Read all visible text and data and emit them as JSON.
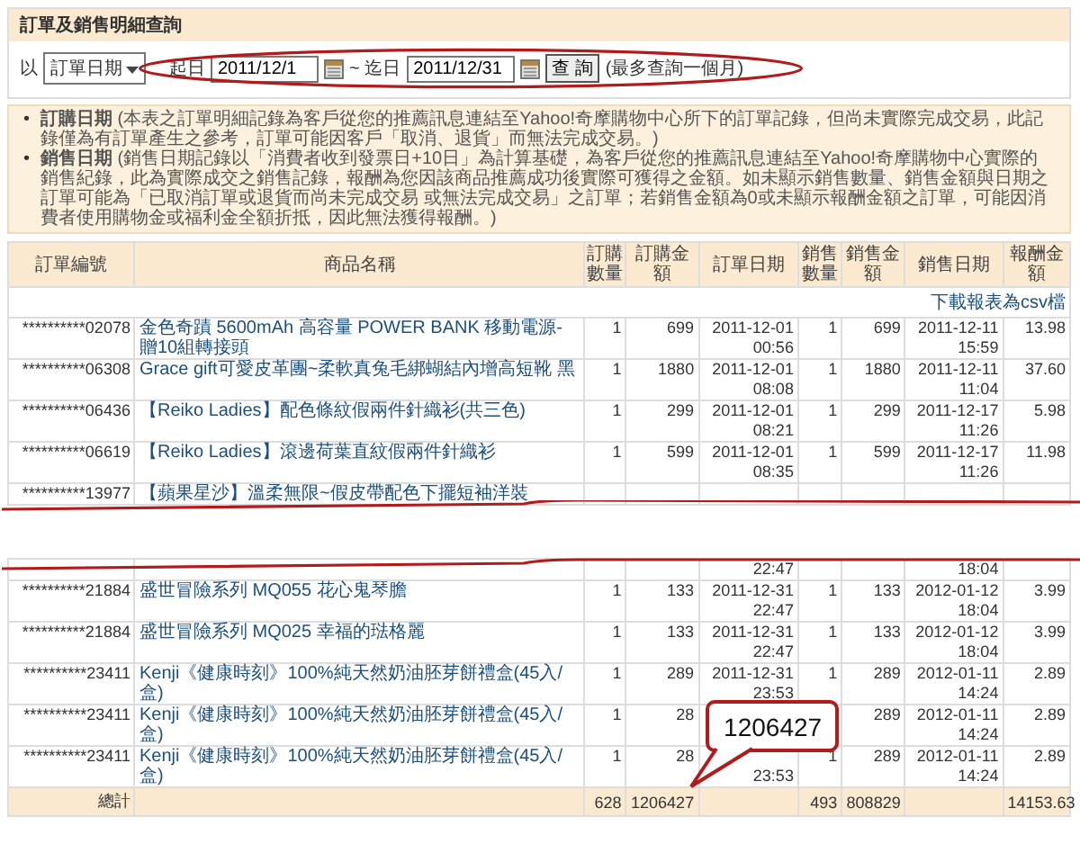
{
  "panel": {
    "title": "訂單及銷售明細查詢"
  },
  "filter": {
    "prefix": "以",
    "field_select": "訂單日期",
    "start_label": "起日",
    "start_date": "2011/12/1",
    "separator": "~ 迄日",
    "end_date": "2011/12/31",
    "button": "查 詢",
    "hint": "(最多查詢一個月)"
  },
  "notes": [
    {
      "marker": "•",
      "text": "**訂購日期** (本表之訂單明細記錄為客戶從您的推薦訊息連結至Yahoo!奇摩購物中心所下的訂單記錄，但尚未實際完成交易，此記錄僅為有訂單產生之參考，訂單可能因客戶「取消、退貨」而無法完成交易。)"
    },
    {
      "marker": "•",
      "text": "**銷售日期** (銷售日期記錄以「消費者收到發票日+10日」為計算基礎，為客戶從您的推薦訊息連結至Yahoo!奇摩購物中心實際的銷售紀錄，此為實際成交之銷售記錄，報酬為您因該商品推薦成功後實際可獲得之金額。如未顯示銷售數量、銷售金額與日期之訂單可能為「已取消訂單或退貨而尚未完成交易 或無法完成交易」之訂單；若銷售金額為0或未顯示報酬金額之訂單，可能因消費者使用購物金或福利金全額折抵，因此無法獲得報酬。)"
    }
  ],
  "table": {
    "columns": [
      "訂單編號",
      "商品名稱",
      "訂購數量",
      "訂購金額",
      "訂單日期",
      "銷售數量",
      "銷售金額",
      "銷售日期",
      "報酬金額"
    ],
    "download_link": "下載報表為csv檔",
    "rows": [
      {
        "kind": "row",
        "cells": [
          "**********02078",
          "金色奇蹟 5600mAh 高容量 POWER BANK 移動電源-贈10組轉接頭",
          "1",
          "699",
          "2011-12-01\n00:56",
          "1",
          "699",
          "2011-12-11\n15:59",
          "13.98"
        ]
      },
      {
        "kind": "row",
        "cells": [
          "**********06308",
          "Grace gift可愛皮革團~柔軟真兔毛綁蝴結內增高短靴 黑",
          "1",
          "1880",
          "2011-12-01\n08:08",
          "1",
          "1880",
          "2011-12-11\n11:04",
          "37.60"
        ]
      },
      {
        "kind": "row",
        "cells": [
          "**********06436",
          "【Reiko Ladies】配色條紋假兩件針織衫(共三色)",
          "1",
          "299",
          "2011-12-01\n08:21",
          "1",
          "299",
          "2011-12-17\n11:26",
          "5.98"
        ]
      },
      {
        "kind": "row",
        "cells": [
          "**********06619",
          "【Reiko Ladies】滾邊荷葉直紋假兩件針織衫",
          "1",
          "599",
          "2011-12-01\n08:35",
          "1",
          "599",
          "2011-12-17\n11:26",
          "11.98"
        ]
      },
      {
        "kind": "partial",
        "cells": [
          "**********13977",
          "【蘋果星沙】溫柔無限~假皮帶配色下擺短袖洋裝",
          null,
          null,
          null,
          null,
          null,
          null,
          null
        ]
      },
      {
        "kind": "cut"
      },
      {
        "kind": "partial",
        "cells": [
          null,
          null,
          null,
          null,
          "22:47",
          null,
          null,
          "18:04",
          null
        ]
      },
      {
        "kind": "row",
        "cells": [
          "**********21884",
          "盛世冒險系列 MQ055 花心鬼琴膽",
          "1",
          "133",
          "2011-12-31\n22:47",
          "1",
          "133",
          "2012-01-12\n18:04",
          "3.99"
        ]
      },
      {
        "kind": "row",
        "cells": [
          "**********21884",
          "盛世冒險系列 MQ025 幸福的琺格麗",
          "1",
          "133",
          "2011-12-31\n22:47",
          "1",
          "133",
          "2012-01-12\n18:04",
          "3.99"
        ]
      },
      {
        "kind": "row",
        "cells": [
          "**********23411",
          "Kenji《健康時刻》100%純天然奶油胚芽餅禮盒(45入/盒)",
          "1",
          "289",
          "2011-12-31\n23:53",
          "1",
          "289",
          "2012-01-11\n14:24",
          "2.89"
        ]
      },
      {
        "kind": "row",
        "cells": [
          "**********23411",
          "Kenji《健康時刻》100%純天然奶油胚芽餅禮盒(45入/盒)",
          "1",
          "28",
          null,
          null,
          "289",
          "2012-01-11\n14:24",
          "2.89"
        ]
      },
      {
        "kind": "row",
        "cells": [
          "**********23411",
          "Kenji《健康時刻》100%純天然奶油胚芽餅禮盒(45入/盒)",
          "1",
          "28",
          "\n23:53",
          "1",
          "289",
          "2012-01-11\n14:24",
          "2.89"
        ]
      }
    ],
    "total": {
      "label": "總計",
      "order_quantity": "628",
      "order_amount": "1206427",
      "sales_quantity": "493",
      "sales_amount": "808829",
      "commission_amount": "14153.63"
    }
  },
  "callout": {
    "text": "1206427"
  }
}
